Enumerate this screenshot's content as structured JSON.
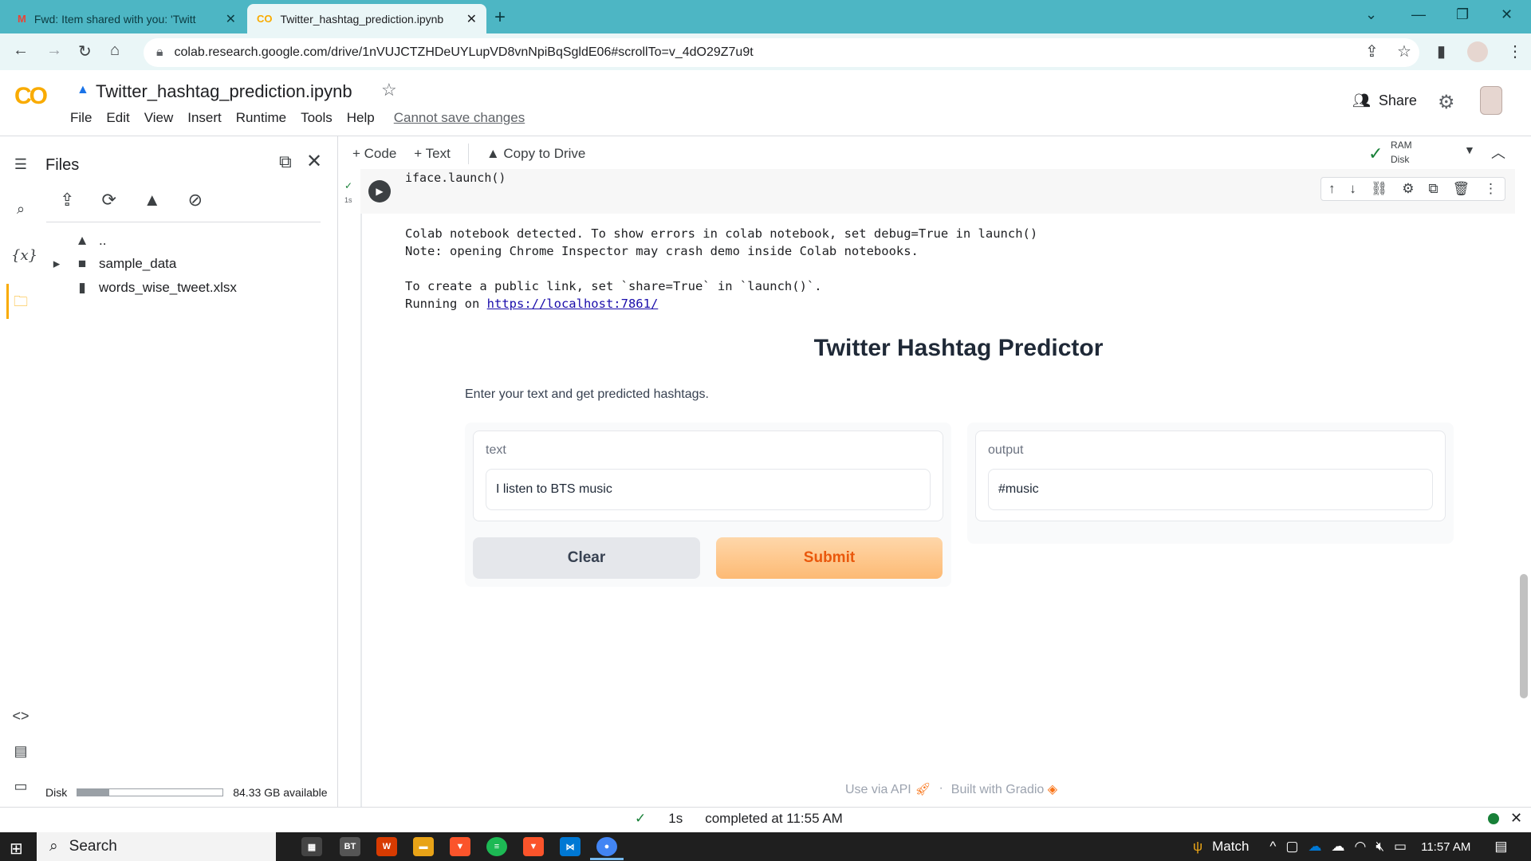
{
  "browser": {
    "tabs": [
      {
        "title": "Fwd: Item shared with you: 'Twitt",
        "icon": "gmail-icon"
      },
      {
        "title": "Twitter_hashtag_prediction.ipynb",
        "icon": "colab-icon"
      }
    ],
    "url": "colab.research.google.com/drive/1nVUJCTZHDeUYLupVD8vnNpiBqSgldE06#scrollTo=v_4dO29Z7u9t"
  },
  "colab": {
    "logo": "CO",
    "notebook_title": "Twitter_hashtag_prediction.ipynb",
    "menu": [
      "File",
      "Edit",
      "View",
      "Insert",
      "Runtime",
      "Tools",
      "Help"
    ],
    "cannot_save": "Cannot save changes",
    "share_label": "Share"
  },
  "files_panel": {
    "title": "Files",
    "tree": [
      {
        "name": "..",
        "type": "up-folder"
      },
      {
        "name": "sample_data",
        "type": "folder"
      },
      {
        "name": "words_wise_tweet.xlsx",
        "type": "file"
      }
    ],
    "disk_label": "Disk",
    "disk_available": "84.33 GB available",
    "disk_used_fraction": 0.22
  },
  "toolbar": {
    "code_label": "Code",
    "text_label": "Text",
    "copy_to_drive": "Copy to Drive",
    "ram_label": "RAM",
    "disk_label": "Disk"
  },
  "cell": {
    "exec_time": "1s",
    "code": "iface.launch()",
    "output_lines": [
      "Colab notebook detected. To show errors in colab notebook, set debug=True in launch()",
      "Note: opening Chrome Inspector may crash demo inside Colab notebooks.",
      "",
      "To create a public link, set `share=True` in `launch()`."
    ],
    "running_on_prefix": "Running on ",
    "running_on_link": "https://localhost:7861/"
  },
  "gradio": {
    "title": "Twitter Hashtag Predictor",
    "description": "Enter your text and get predicted hashtags.",
    "input_label": "text",
    "input_value": "I listen to BTS music",
    "output_label": "output",
    "output_value": "#music",
    "clear_label": "Clear",
    "submit_label": "Submit",
    "footer_api": "Use via API",
    "footer_sep": "·",
    "footer_built": "Built with Gradio"
  },
  "status": {
    "time": "1s",
    "completed": "completed at 11:55 AM"
  },
  "taskbar": {
    "search": "Search",
    "weather": "Match",
    "clock": "11:57 AM"
  },
  "colors": {
    "tab_strip": "#4db6c4",
    "colab_orange": "#f9ab00",
    "submit_text": "#ea580c"
  }
}
